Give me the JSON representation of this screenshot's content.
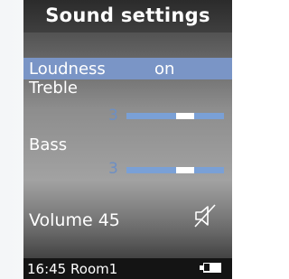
{
  "screen": {
    "title": "Sound settings",
    "loudness": {
      "label": "Loudness",
      "value": "on"
    },
    "treble": {
      "label": "Treble",
      "value": "3",
      "level_fraction": 0.6
    },
    "bass": {
      "label": "Bass",
      "value": "3",
      "level_fraction": 0.6
    },
    "volume": {
      "label": "Volume 45",
      "icon": "mute-icon"
    }
  },
  "status_bar": {
    "time": "16:45",
    "room": "Room1",
    "battery_icon": "battery-icon"
  },
  "colors": {
    "highlight": "#7a95c6",
    "level_value": "#6d8fc4",
    "slider_track": "#7aa0d6"
  }
}
